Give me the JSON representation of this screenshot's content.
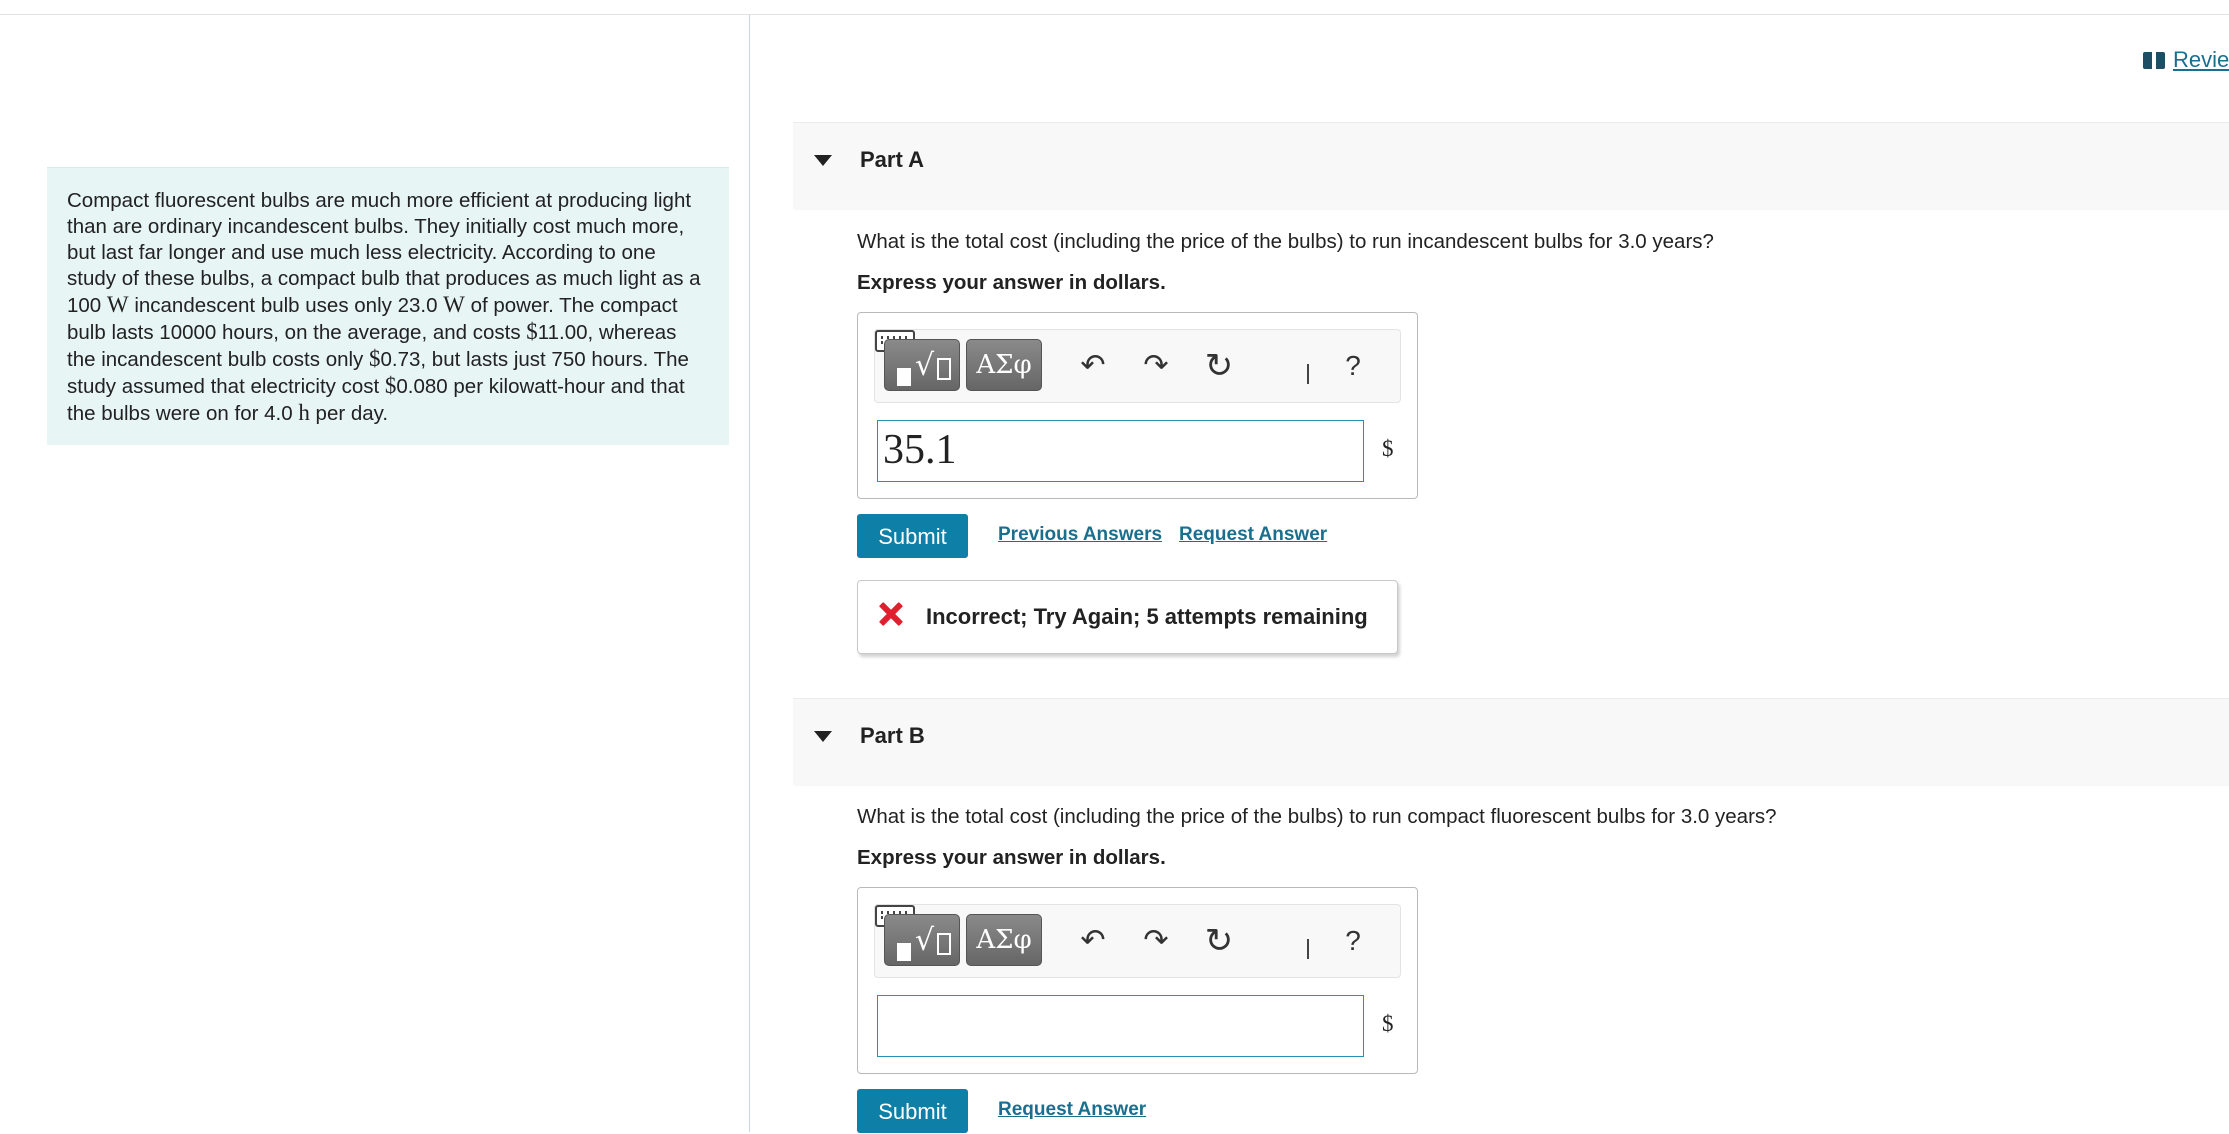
{
  "intro": {
    "text_1": "Compact fluorescent bulbs are much more efficient at producing light than are ordinary incandescent bulbs. They initially cost much more, but last far longer and use much less electricity. According to one study of these bulbs, a compact bulb that produces as much light as a 100 ",
    "unit_watt_1": "W",
    "text_2": " incandescent bulb uses only 23.0 ",
    "unit_watt_2": "W",
    "text_3": " of power. The compact bulb lasts 10000 hours, on the average, and costs ",
    "dollar_1": "$",
    "text_4": "11.00, whereas the incandescent bulb costs only ",
    "dollar_2": "$",
    "text_5": "0.73, but lasts just 750 hours. The study assumed that electricity cost ",
    "dollar_3": "$",
    "text_6": "0.080 per kilowatt-hour and that the bulbs were on for 4.0 ",
    "unit_hour": "h",
    "text_7": " per day."
  },
  "header": {
    "review_link": "Revie",
    "review_icon": "book-icon"
  },
  "toolbar": {
    "symbols_label": "ΑΣφ",
    "undo_glyph": "↶",
    "redo_glyph": "↷",
    "reset_glyph": "↻",
    "help_label": "?"
  },
  "part_a": {
    "title": "Part A",
    "question": "What is the total cost (including the price of the bulbs) to run incandescent bulbs for 3.0 years?",
    "instruction": "Express your answer in dollars.",
    "answer_value": "35.1",
    "unit": "$",
    "submit_label": "Submit",
    "previous_answers_label": "Previous Answers",
    "request_answer_label": "Request Answer",
    "feedback": "Incorrect; Try Again; 5 attempts remaining",
    "feedback_color": "#e0202e"
  },
  "part_b": {
    "title": "Part B",
    "question": "What is the total cost (including the price of the bulbs) to run compact fluorescent bulbs for 3.0 years?",
    "instruction": "Express your answer in dollars.",
    "answer_value": "",
    "unit": "$",
    "submit_label": "Submit",
    "request_answer_label": "Request Answer"
  },
  "colors": {
    "accent": "#0e7fa6",
    "link": "#1a6f8f",
    "intro_bg": "#e7f5f5"
  }
}
